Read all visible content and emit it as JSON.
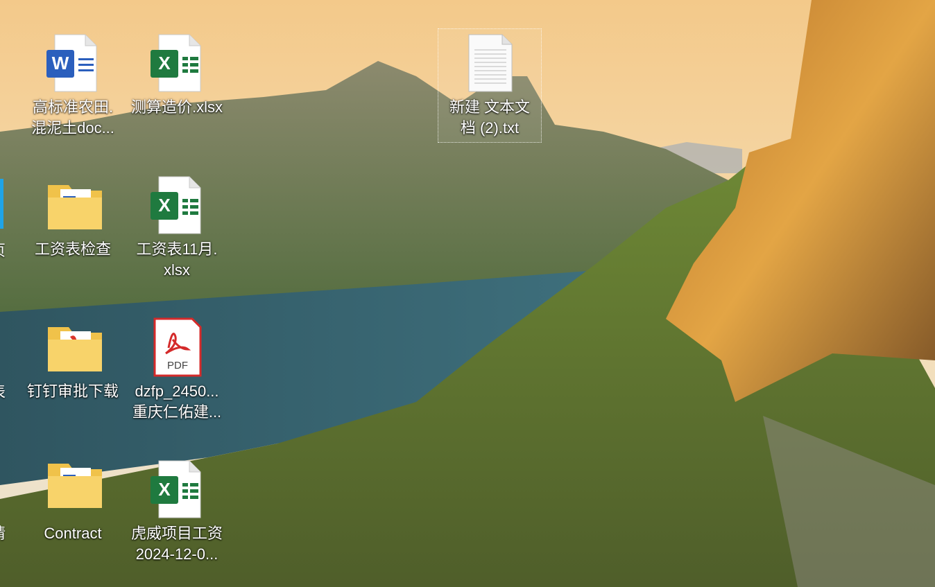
{
  "desktop": {
    "icons": [
      {
        "label": "高标准农田.\n混泥土doc...",
        "type": "word"
      },
      {
        "label": "测算造价.xlsx",
        "type": "excel"
      },
      {
        "label": "新建 文本文\n档 (2).txt",
        "type": "text",
        "selected": true
      },
      {
        "label": "工资表检查",
        "type": "folder-word"
      },
      {
        "label": "工资表11月.\nxlsx",
        "type": "excel"
      },
      {
        "label": "钉钉审批下载",
        "type": "folder-pdf"
      },
      {
        "label": "dzfp_2450...\n重庆仁佑建...",
        "type": "pdf"
      },
      {
        "label": "Contract",
        "type": "folder-word"
      },
      {
        "label": "虎威项目工资\n2024-12-0...",
        "type": "excel"
      }
    ],
    "edge_fragments": [
      "页",
      "表",
      "请"
    ],
    "pdf_badge": "PDF"
  }
}
